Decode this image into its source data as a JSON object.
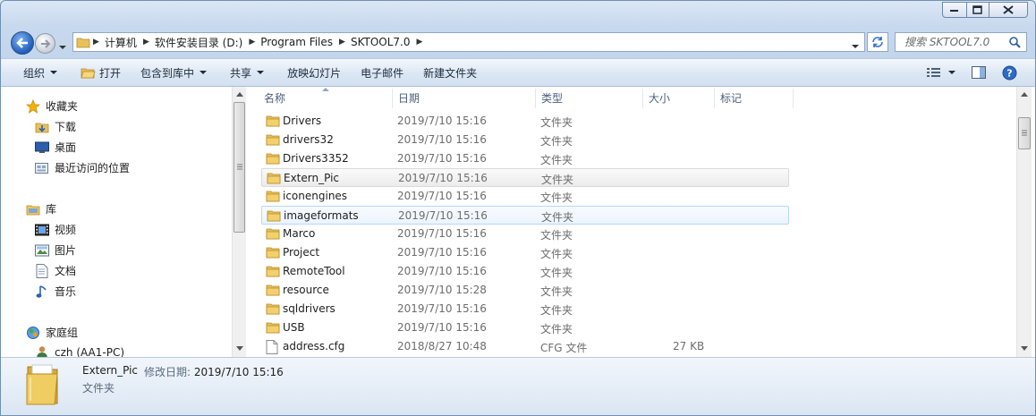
{
  "window": {
    "controls": [
      "minimize",
      "maximize",
      "close"
    ]
  },
  "address": {
    "crumbs": [
      "计算机",
      "软件安装目录 (D:)",
      "Program Files",
      "SKTOOL7.0"
    ]
  },
  "search": {
    "placeholder": "搜索 SKTOOL7.0"
  },
  "toolbar": {
    "organize": "组织",
    "open": "打开",
    "include_in_library": "包含到库中",
    "share": "共享",
    "slideshow": "放映幻灯片",
    "email": "电子邮件",
    "new_folder": "新建文件夹"
  },
  "nav": {
    "favorites": "收藏夹",
    "downloads": "下载",
    "desktop": "桌面",
    "recent": "最近访问的位置",
    "libraries": "库",
    "videos": "视频",
    "pictures": "图片",
    "documents": "文档",
    "music": "音乐",
    "homegroup": "家庭组",
    "user": "czh (AA1-PC)"
  },
  "columns": {
    "name": "名称",
    "date": "日期",
    "type": "类型",
    "size": "大小",
    "tags": "标记"
  },
  "files": [
    {
      "name": "Drivers",
      "date": "2019/7/10 15:16",
      "type": "文件夹",
      "size": "",
      "kind": "folder",
      "state": ""
    },
    {
      "name": "drivers32",
      "date": "2019/7/10 15:16",
      "type": "文件夹",
      "size": "",
      "kind": "folder",
      "state": ""
    },
    {
      "name": "Drivers3352",
      "date": "2019/7/10 15:16",
      "type": "文件夹",
      "size": "",
      "kind": "folder",
      "state": ""
    },
    {
      "name": "Extern_Pic",
      "date": "2019/7/10 15:16",
      "type": "文件夹",
      "size": "",
      "kind": "folder",
      "state": "selected"
    },
    {
      "name": "iconengines",
      "date": "2019/7/10 15:16",
      "type": "文件夹",
      "size": "",
      "kind": "folder",
      "state": ""
    },
    {
      "name": "imageformats",
      "date": "2019/7/10 15:16",
      "type": "文件夹",
      "size": "",
      "kind": "folder",
      "state": "hover"
    },
    {
      "name": "Marco",
      "date": "2019/7/10 15:16",
      "type": "文件夹",
      "size": "",
      "kind": "folder",
      "state": ""
    },
    {
      "name": "Project",
      "date": "2019/7/10 15:16",
      "type": "文件夹",
      "size": "",
      "kind": "folder",
      "state": ""
    },
    {
      "name": "RemoteTool",
      "date": "2019/7/10 15:16",
      "type": "文件夹",
      "size": "",
      "kind": "folder",
      "state": ""
    },
    {
      "name": "resource",
      "date": "2019/7/10 15:28",
      "type": "文件夹",
      "size": "",
      "kind": "folder",
      "state": ""
    },
    {
      "name": "sqldrivers",
      "date": "2019/7/10 15:16",
      "type": "文件夹",
      "size": "",
      "kind": "folder",
      "state": ""
    },
    {
      "name": "USB",
      "date": "2019/7/10 15:16",
      "type": "文件夹",
      "size": "",
      "kind": "folder",
      "state": ""
    },
    {
      "name": "address.cfg",
      "date": "2018/8/27 10:48",
      "type": "CFG 文件",
      "size": "27 KB",
      "kind": "file",
      "state": ""
    }
  ],
  "details": {
    "name": "Extern_Pic",
    "modified_label": "修改日期:",
    "modified_value": "2019/7/10 15:16",
    "type": "文件夹"
  },
  "colors": {
    "folder": "#e8c15a",
    "accent": "#1f5dbb",
    "select_border": "#b8d6fb"
  }
}
